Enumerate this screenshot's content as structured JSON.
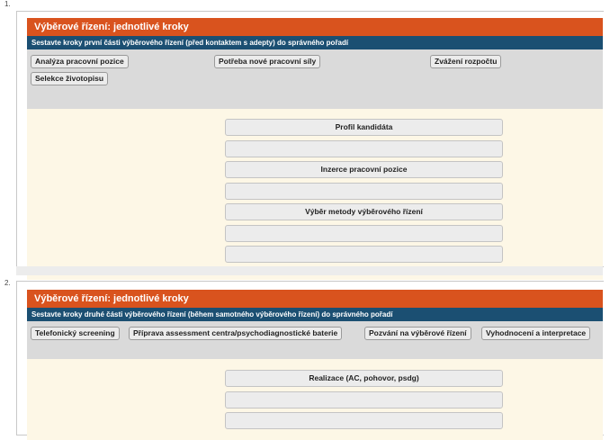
{
  "questions": [
    {
      "number": "1.",
      "title": "Výběrové řízení: jednotlivé kroky",
      "instruction": "Sestavte kroky první části výběrového řízení (před kontaktem s adepty) do správného pořadí",
      "options": [
        "Analýza pracovní pozice",
        "Potřeba nové pracovní síly",
        "Zvážení rozpočtu",
        "Selekce životopisu"
      ],
      "slots": [
        "Profil kandidáta",
        "",
        "Inzerce pracovní pozice",
        "",
        "Výběr metody výběrového řízení",
        "",
        ""
      ]
    },
    {
      "number": "2.",
      "title": "Výběrové řízení: jednotlivé kroky",
      "instruction": "Sestavte kroky druhé části výběrového řízení (během samotného výběrového řízení) do správného pořadí",
      "options": [
        "Telefonický screening",
        "Příprava assessment centra/psychodiagnostické baterie",
        "Pozvání na výběrové řízení",
        "Vyhodnocení a interpretace"
      ],
      "slots": [
        "Realizace (AC, pohovor, psdg)",
        "",
        ""
      ]
    }
  ],
  "colors": {
    "title_bg": "#d9531e",
    "instruction_bg": "#1b4f72",
    "pool_bg": "#dadada",
    "drop_bg": "#fdf7e6"
  }
}
